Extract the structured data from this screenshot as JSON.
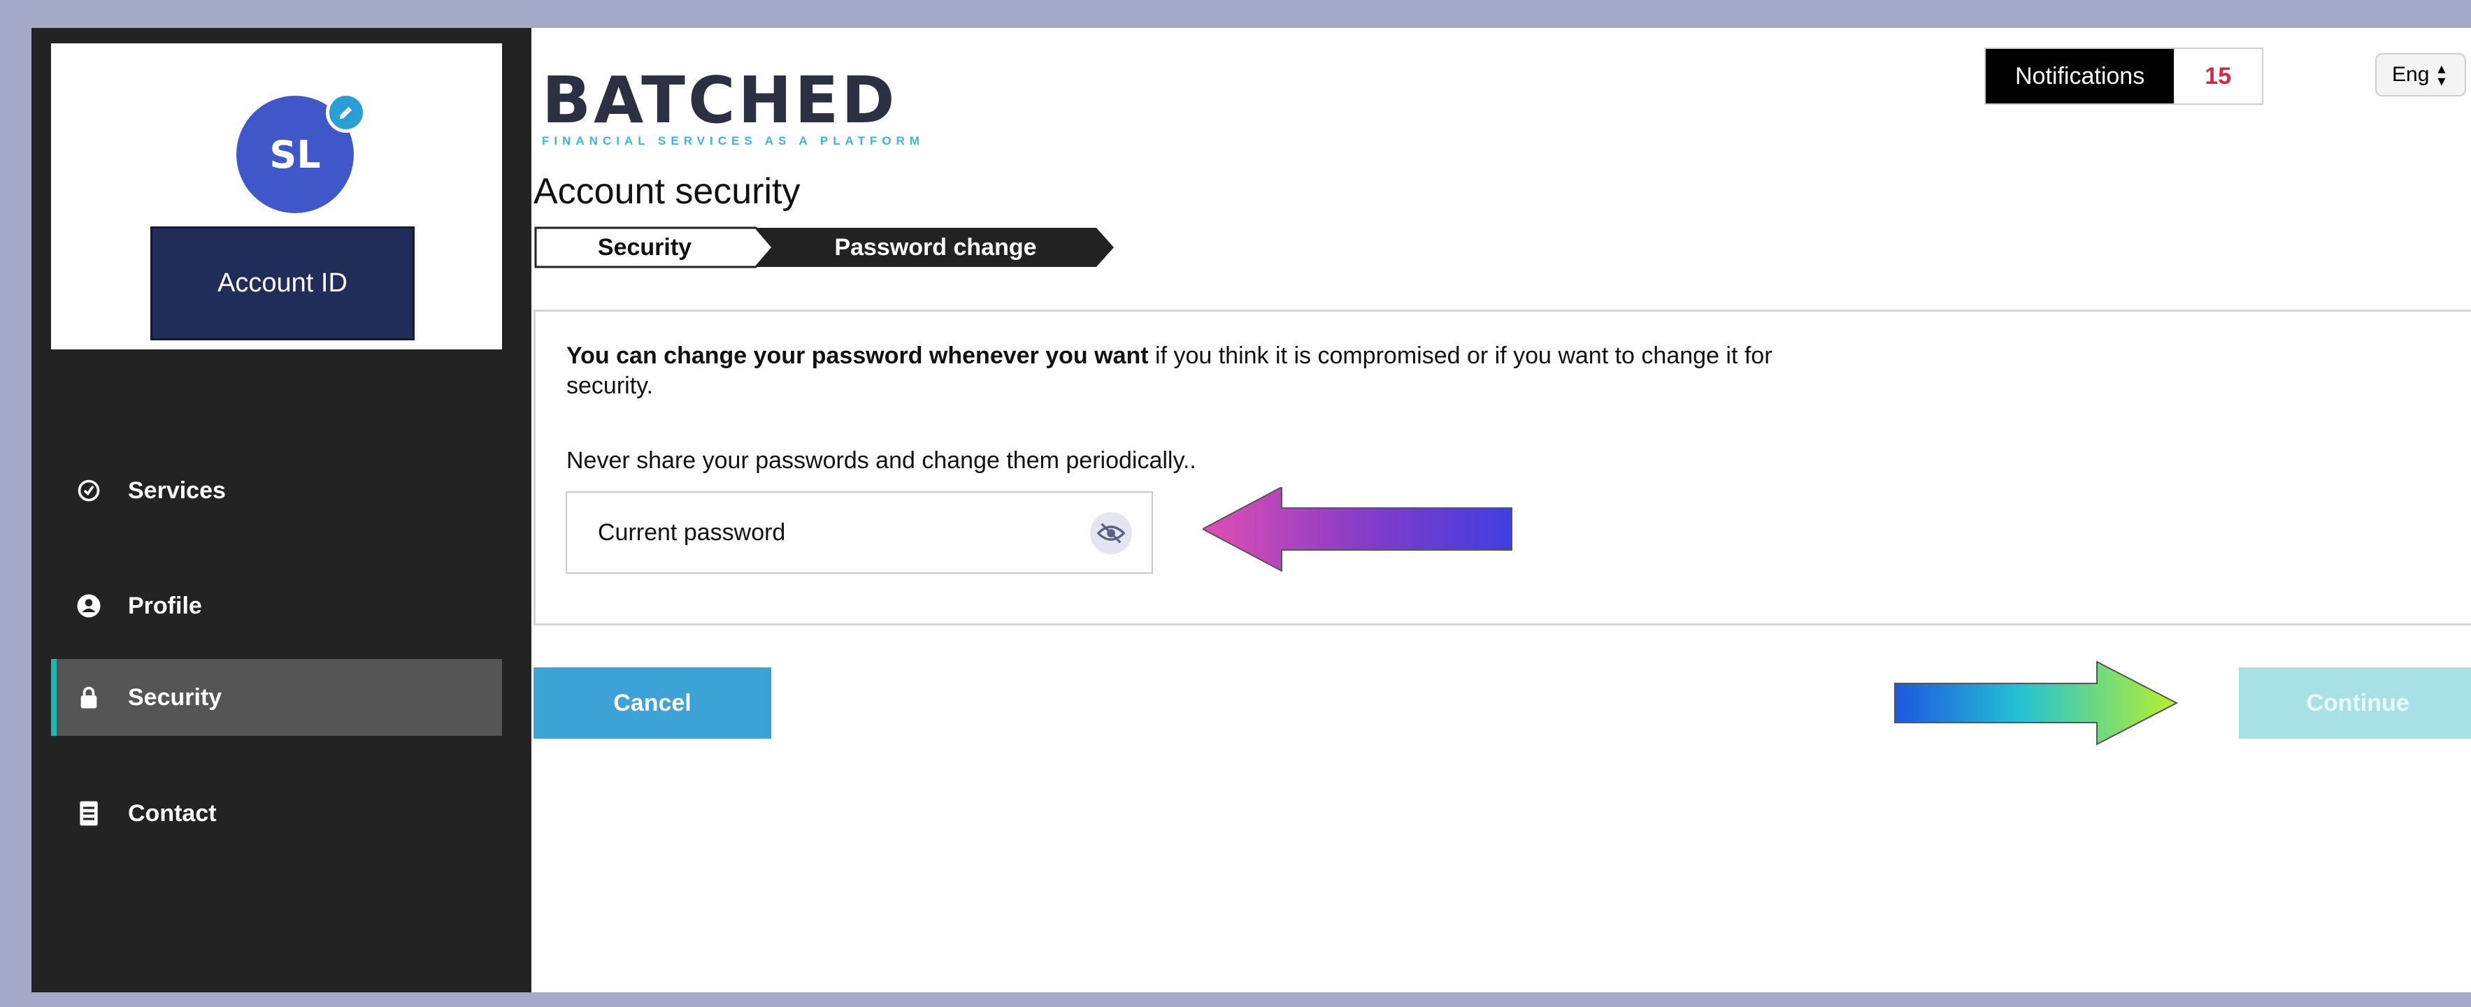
{
  "sidebar": {
    "avatar_initials": "SL",
    "account_id_label": "Account ID",
    "items": [
      {
        "label": "Services",
        "icon": "services-icon"
      },
      {
        "label": "Profile",
        "icon": "profile-icon"
      },
      {
        "label": "Security",
        "icon": "lock-icon",
        "active": true
      },
      {
        "label": "Contact",
        "icon": "document-icon"
      }
    ]
  },
  "header": {
    "logo_text": "BATCHED",
    "logo_tagline": "FINANCIAL SERVICES AS A PLATFORM",
    "notifications_label": "Notifications",
    "notifications_count": "15",
    "language": "Eng"
  },
  "page": {
    "title": "Account security",
    "steps": [
      {
        "label": "Security",
        "active": false
      },
      {
        "label": "Password change",
        "active": true
      }
    ],
    "description_bold": "You can change your password whenever you want",
    "description_rest": " if you think it is compromised or if you want to change it for security.",
    "hint": "Never share your passwords and change them periodically..",
    "current_password_placeholder": "Current password"
  },
  "actions": {
    "cancel_label": "Cancel",
    "continue_label": "Continue"
  },
  "colors": {
    "sidebar_bg": "#232323",
    "accent": "#1fb6b0",
    "cancel_bg": "#3da3d6",
    "continue_bg_disabled": "#a7e1e6",
    "notification_count": "#e0243b"
  }
}
